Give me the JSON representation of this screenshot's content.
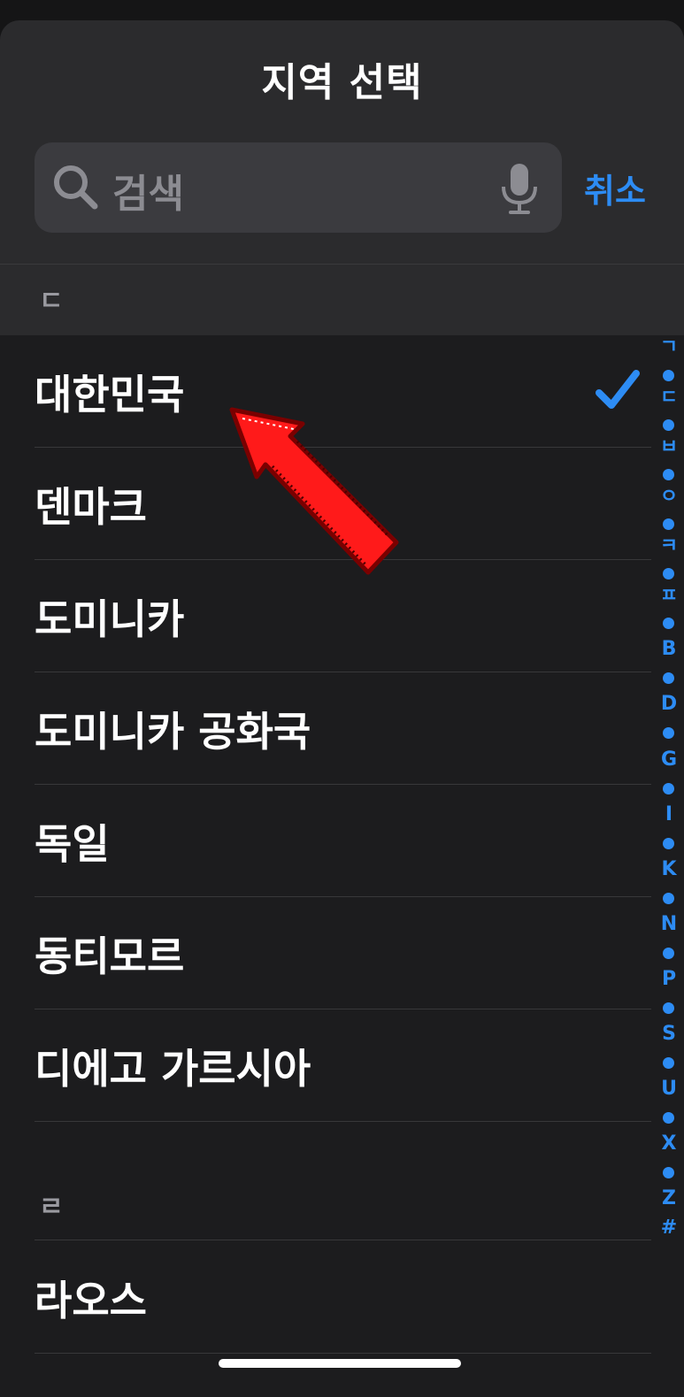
{
  "sheet": {
    "title": "지역 선택",
    "search": {
      "placeholder": "검색",
      "cancel_label": "취소"
    }
  },
  "sections": [
    {
      "header": "ㄷ",
      "items": [
        {
          "label": "대한민국",
          "selected": true
        },
        {
          "label": "덴마크",
          "selected": false
        },
        {
          "label": "도미니카",
          "selected": false
        },
        {
          "label": "도미니카 공화국",
          "selected": false
        },
        {
          "label": "독일",
          "selected": false
        },
        {
          "label": "동티모르",
          "selected": false
        },
        {
          "label": "디에고 가르시아",
          "selected": false
        }
      ]
    },
    {
      "header": "ㄹ",
      "items": [
        {
          "label": "라오스",
          "selected": false
        }
      ]
    }
  ],
  "index": [
    "ㄱ",
    "•",
    "ㄷ",
    "•",
    "ㅂ",
    "•",
    "ㅇ",
    "•",
    "ㅋ",
    "•",
    "ㅍ",
    "•",
    "B",
    "•",
    "D",
    "•",
    "G",
    "•",
    "I",
    "•",
    "K",
    "•",
    "N",
    "•",
    "P",
    "•",
    "S",
    "•",
    "U",
    "•",
    "X",
    "•",
    "Z",
    "#"
  ],
  "icons": {
    "search": "search-icon",
    "mic": "microphone-icon",
    "check": "checkmark-icon",
    "annotation": "red-arrow-annotation"
  },
  "colors": {
    "accent": "#2d8cf4",
    "background": "#1c1c1e",
    "header_background": "#2b2b2d",
    "annotation": "#ff1a1a"
  }
}
